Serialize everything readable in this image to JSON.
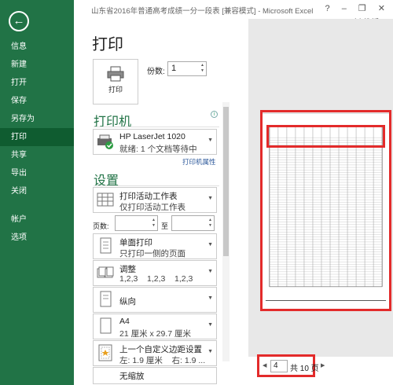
{
  "titlebar": {
    "title": "山东省2016年普通高考成绩一分一段表 [兼容模式] - Microsoft Excel",
    "window_controls": "? – ❐ ✕",
    "user": "刘 教授 ▾"
  },
  "sidebar": {
    "back_icon": "back-arrow-icon",
    "items": [
      {
        "label": "信息"
      },
      {
        "label": "新建"
      },
      {
        "label": "打开"
      },
      {
        "label": "保存"
      },
      {
        "label": "另存为"
      },
      {
        "label": "打印",
        "active": true
      },
      {
        "label": "共享"
      },
      {
        "label": "导出"
      },
      {
        "label": "关闭"
      },
      {
        "label": "帐户"
      },
      {
        "label": "选项"
      }
    ]
  },
  "print": {
    "title": "打印",
    "button_label": "打印",
    "copies_label": "份数:",
    "copies_value": "1"
  },
  "printer": {
    "header": "打印机",
    "name": "HP LaserJet 1020",
    "status": "就绪: 1 个文档等待中",
    "properties_link": "打印机属性"
  },
  "settings": {
    "header": "设置",
    "what": {
      "l1": "打印活动工作表",
      "l2": "仅打印活动工作表"
    },
    "pages_label": "页数:",
    "pages_to": "至",
    "sides": {
      "l1": "单面打印",
      "l2": "只打印一侧的页面"
    },
    "collate": {
      "l1": "调整",
      "l2": "1,2,3    1,2,3    1,2,3"
    },
    "orientation": {
      "l1": "纵向"
    },
    "paper": {
      "l1": "A4",
      "l2": "21 厘米 x 29.7 厘米"
    },
    "margins": {
      "l1": "上一个自定义边距设置",
      "l2": "左: 1.9 厘米    右: 1.9 ..."
    },
    "scaling": {
      "l1": "无缩放"
    }
  },
  "preview": {
    "current_page": "4",
    "total_pages": "共 10 页",
    "prev_icon": "triangle-left-icon",
    "next_icon": "triangle-right-icon"
  },
  "colors": {
    "accent": "#217346",
    "highlight": "#e32b2b"
  }
}
